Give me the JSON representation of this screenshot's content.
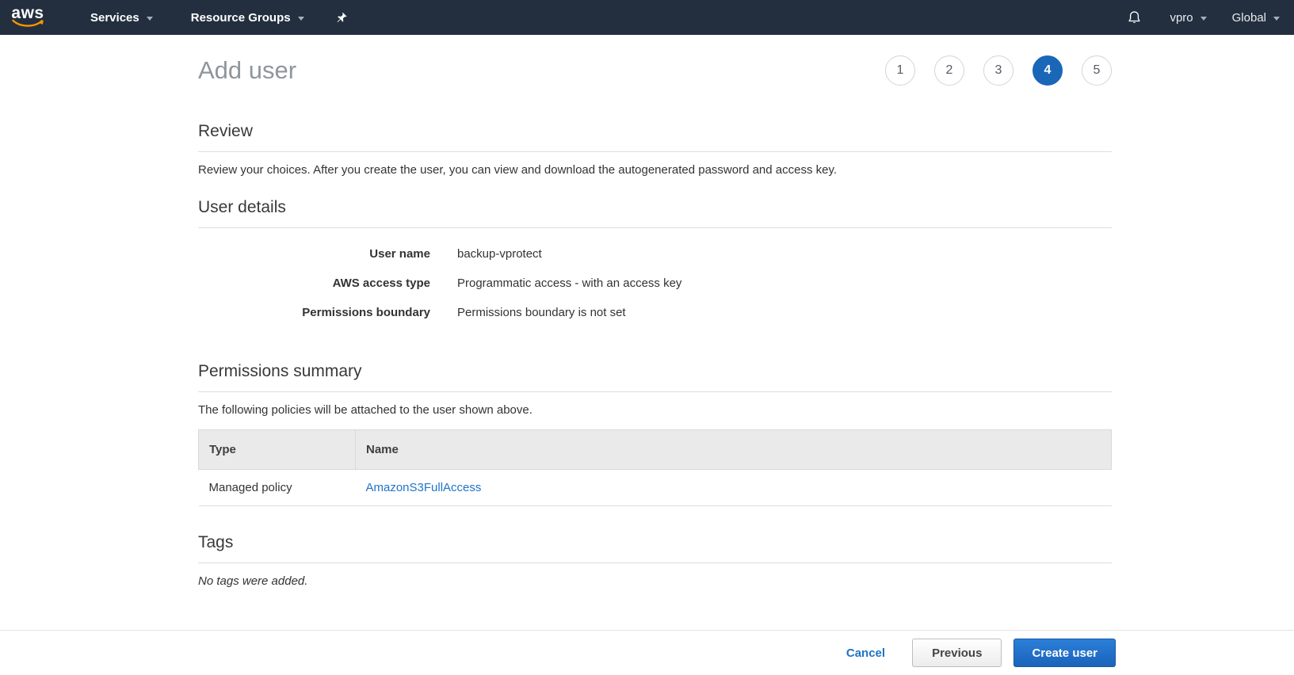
{
  "navbar": {
    "logo_text": "aws",
    "services_label": "Services",
    "resource_groups_label": "Resource Groups",
    "account_label": "vpro",
    "region_label": "Global"
  },
  "wizard": {
    "title": "Add user",
    "steps": [
      "1",
      "2",
      "3",
      "4",
      "5"
    ],
    "active_step": "4"
  },
  "review": {
    "heading": "Review",
    "description": "Review your choices. After you create the user, you can view and download the autogenerated password and access key."
  },
  "user_details": {
    "heading": "User details",
    "rows": [
      {
        "label": "User name",
        "value": "backup-vprotect"
      },
      {
        "label": "AWS access type",
        "value": "Programmatic access - with an access key"
      },
      {
        "label": "Permissions boundary",
        "value": "Permissions boundary is not set"
      }
    ]
  },
  "permissions": {
    "heading": "Permissions summary",
    "description": "The following policies will be attached to the user shown above.",
    "table": {
      "columns": [
        "Type",
        "Name"
      ],
      "rows": [
        {
          "type": "Managed policy",
          "name": "AmazonS3FullAccess"
        }
      ]
    }
  },
  "tags": {
    "heading": "Tags",
    "empty_message": "No tags were added."
  },
  "footer": {
    "cancel_label": "Cancel",
    "previous_label": "Previous",
    "create_label": "Create user"
  },
  "icons": {
    "logo_smile": "aws-smile-icon",
    "pin": "pin-icon",
    "bell": "bell-icon",
    "caret": "chevron-down-icon"
  },
  "colors": {
    "navbar_bg": "#232f3e",
    "logo_smile": "#f79400",
    "active_step": "#1a67b8",
    "link": "#2074c8",
    "primary_button": "#1f6dc7",
    "title_gray": "#8f969b",
    "table_header_bg": "#eaeaea"
  }
}
